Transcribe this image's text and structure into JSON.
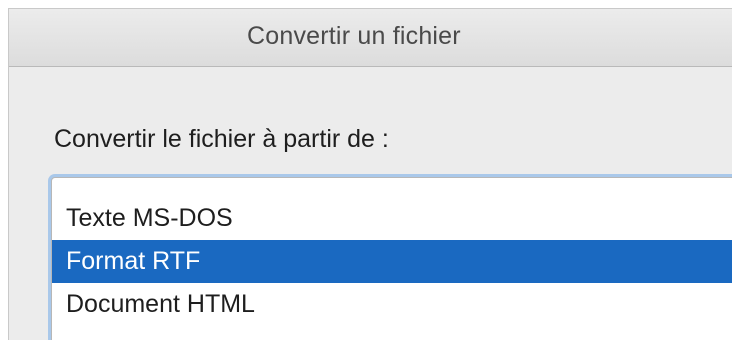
{
  "dialog": {
    "title": "Convertir un fichier",
    "prompt": "Convertir le fichier à partir de :"
  },
  "list": {
    "items": [
      {
        "label": "Texte MS-DOS",
        "selected": false
      },
      {
        "label": "Format RTF",
        "selected": true
      },
      {
        "label": "Document HTML",
        "selected": false
      }
    ],
    "selected_color": "#1a69c1"
  }
}
